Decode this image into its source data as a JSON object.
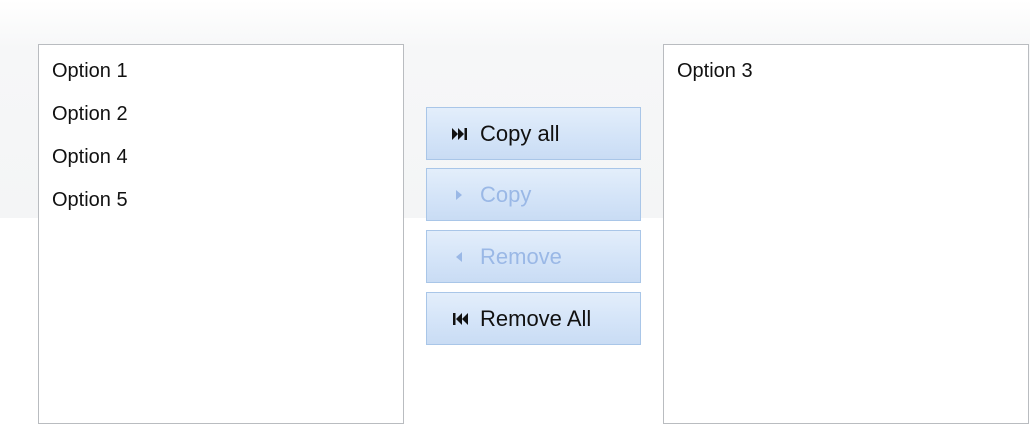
{
  "available_list": {
    "items": [
      "Option 1",
      "Option 2",
      "Option 4",
      "Option 5"
    ]
  },
  "selected_list": {
    "items": [
      "Option 3"
    ]
  },
  "buttons": {
    "copy_all": {
      "label": "Copy all",
      "icon": "fast-forward-icon",
      "enabled": true
    },
    "copy": {
      "label": "Copy",
      "icon": "play-right-icon",
      "enabled": false
    },
    "remove": {
      "label": "Remove",
      "icon": "play-left-icon",
      "enabled": false
    },
    "remove_all": {
      "label": "Remove All",
      "icon": "rewind-icon",
      "enabled": true
    }
  },
  "colors": {
    "button_fill": "#d4e4f8",
    "button_border": "#a9c6e8",
    "disabled_text": "#9ab8e6",
    "list_border": "#b9bcc0"
  }
}
